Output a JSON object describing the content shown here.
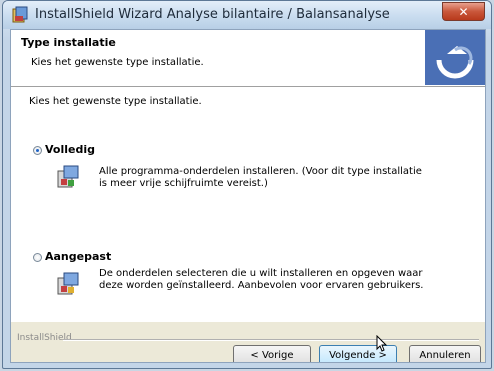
{
  "window": {
    "title": "InstallShield Wizard Analyse bilantaire / Balansanalyse",
    "close_label": "✕"
  },
  "header": {
    "title": "Type installatie",
    "subtitle": "Kies het gewenste type installatie."
  },
  "body": {
    "prompt": "Kies het gewenste type installatie.",
    "options": [
      {
        "label": "Volledig",
        "selected": true,
        "description": "Alle programma-onderdelen installeren. (Voor dit type installatie is meer vrije schijfruimte vereist.)"
      },
      {
        "label": "Aangepast",
        "selected": false,
        "description": "De onderdelen selecteren die u wilt installeren en opgeven waar deze worden geïnstalleerd. Aanbevolen voor ervaren gebruikers."
      }
    ]
  },
  "footer": {
    "brand": "InstallShield",
    "back_label": "< Vorige",
    "next_label": "Volgende >",
    "cancel_label": "Annuleren"
  },
  "colors": {
    "accent": "#1f63c6",
    "close": "#c9573b",
    "logo": "#4a6fb5"
  }
}
